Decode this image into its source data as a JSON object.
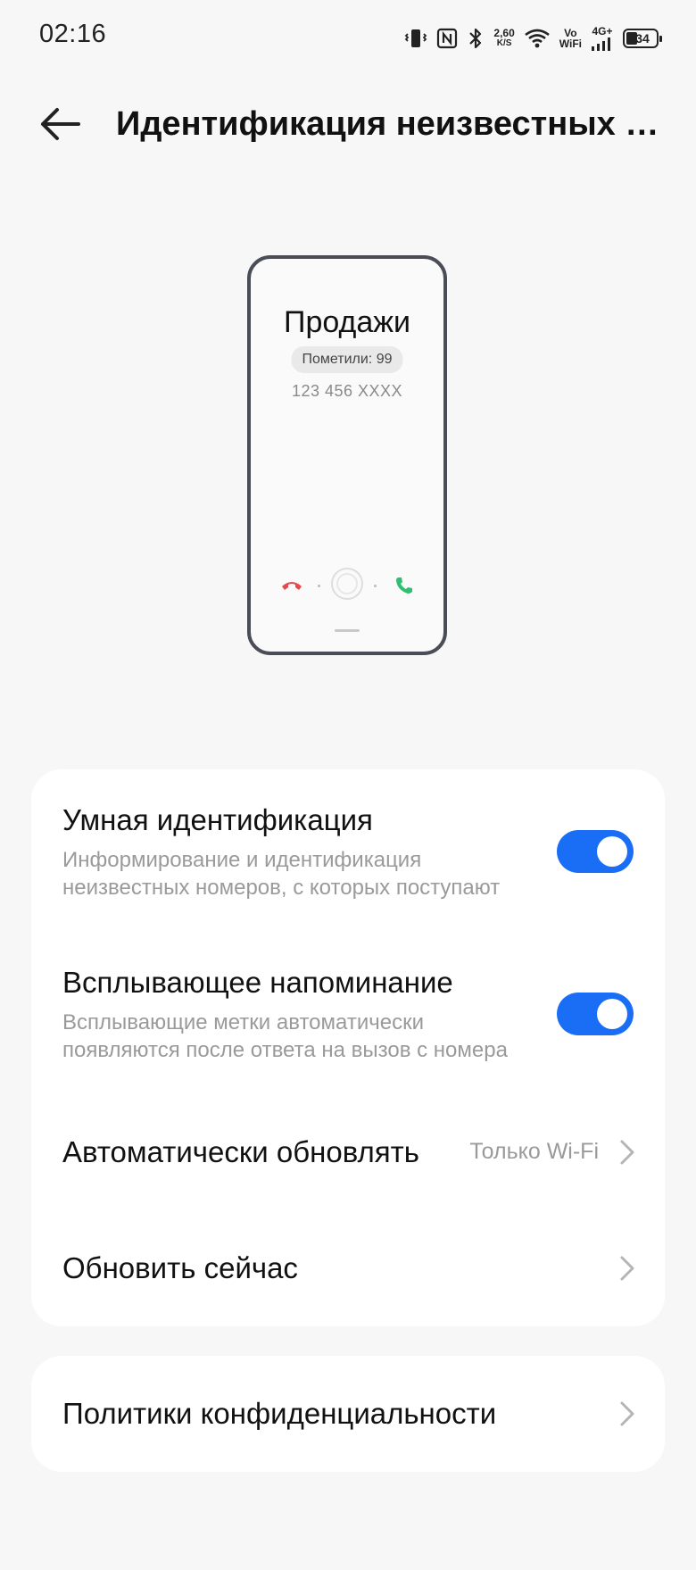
{
  "status_bar": {
    "time": "02:16",
    "net_speed_value": "2,60",
    "net_speed_unit": "K/S",
    "vowifi_top": "Vo",
    "vowifi_bottom": "WiFi",
    "network_type": "4G+",
    "battery": "34",
    "icons": [
      "vibrate-icon",
      "nfc-icon",
      "bluetooth-icon",
      "wifi-icon",
      "signal-icon",
      "battery-icon"
    ]
  },
  "header": {
    "title": "Идентификация неизвестных номеров",
    "back_icon": "arrow-left-icon"
  },
  "illustration": {
    "caller_name": "Продажи",
    "tag": "Пометили: 99",
    "number": "123 456 XXXX"
  },
  "settings": {
    "smart_id": {
      "title": "Умная идентификация",
      "sub_line1": "Информирование и идентификация",
      "sub_line2": "неизвестных номеров, с которых поступают",
      "enabled": true
    },
    "popup_reminder": {
      "title": "Всплывающее напоминание",
      "sub_line1": "Всплывающие метки автоматически",
      "sub_line2": "появляются после ответа на вызов с номера",
      "enabled": true
    },
    "auto_update": {
      "title": "Автоматически обновлять",
      "value": "Только Wi-Fi"
    },
    "update_now": {
      "title": "Обновить сейчас"
    },
    "privacy": {
      "title": "Политики конфиденциальности"
    }
  },
  "colors": {
    "accent": "#1a6ef5",
    "decline": "#e5484d",
    "accept": "#2fbf71",
    "background": "#f7f7f7"
  }
}
